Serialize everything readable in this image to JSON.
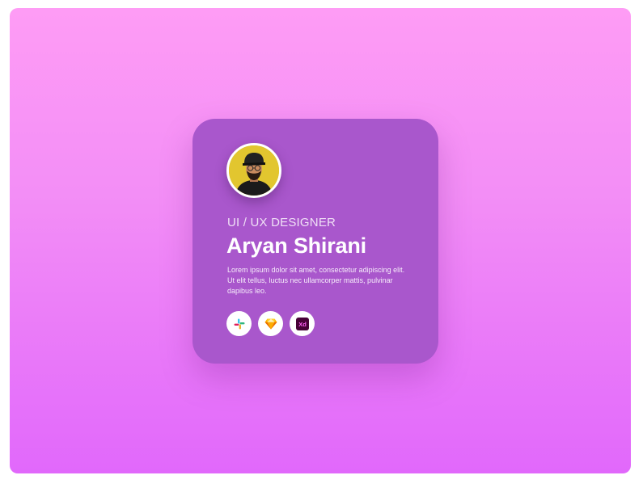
{
  "profile": {
    "role": "UI / UX DESIGNER",
    "name": "Aryan Shirani",
    "bio": "Lorem ipsum dolor sit amet, consectetur adipiscing elit. Ut elit tellus, luctus nec ullamcorper mattis, pulvinar dapibus leo.",
    "avatar": "avatar-photo"
  },
  "tools": [
    {
      "icon": "slack-icon"
    },
    {
      "icon": "sketch-icon"
    },
    {
      "icon": "adobe-xd-icon",
      "label": "Xd"
    }
  ],
  "colors": {
    "background_top": "#fe9cf5",
    "background_bottom": "#e168fb",
    "card": "#a957cc",
    "text": "#ffffff",
    "xd_bg": "#470137",
    "xd_text": "#ff61f6"
  }
}
